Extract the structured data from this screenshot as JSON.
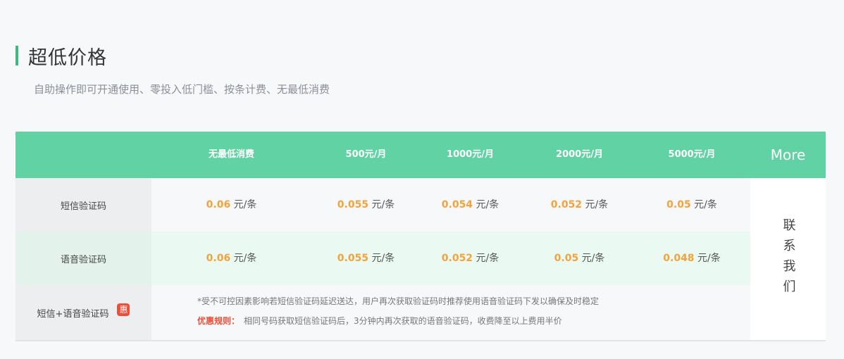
{
  "section": {
    "title": "超低价格",
    "subtitle": "自助操作即可开通使用、零投入低门槛、按条计费、无最低消费"
  },
  "table": {
    "headers": [
      "无最低消费",
      "500元/月",
      "1000元/月",
      "2000元/月",
      "5000元/月",
      "More"
    ],
    "unit": "元/条",
    "rows": [
      {
        "label": "短信验证码",
        "prices": [
          "0.06",
          "0.055",
          "0.054",
          "0.052",
          "0.05"
        ]
      },
      {
        "label": "语音验证码",
        "prices": [
          "0.06",
          "0.055",
          "0.052",
          "0.05",
          "0.048"
        ]
      }
    ],
    "combo": {
      "label": "短信+语音验证码",
      "badge": "惠",
      "note": "*受不可控因素影响若短信验证码延迟送达，用户再次获取验证码时推荐使用语音验证码下发以确保及时稳定",
      "rule_label": "优惠规则：",
      "rule_text": "相同号码获取短信验证码后，3分钟内再次获取的语音验证码，收费降至以上费用半价"
    },
    "contact": "联系我们"
  },
  "colors": {
    "header_bg": "#61d2a4",
    "accent_bar": "#3cba7c",
    "price": "#f5a23a",
    "badge": "#e8503a"
  }
}
